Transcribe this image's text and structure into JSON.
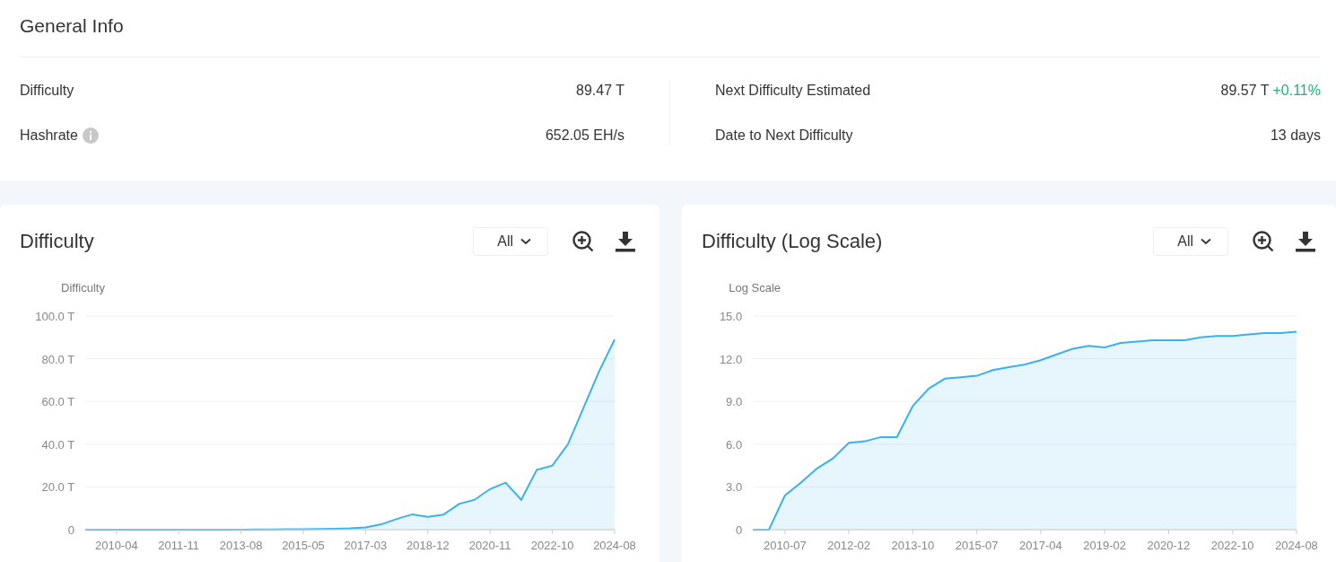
{
  "general_info": {
    "title": "General Info",
    "left": [
      {
        "label": "Difficulty",
        "value": "89.47 T",
        "info": false
      },
      {
        "label": "Hashrate",
        "value": "652.05 EH/s",
        "info": true
      }
    ],
    "right": [
      {
        "label": "Next Difficulty Estimated",
        "value": "89.57 T",
        "change": "+0.11%"
      },
      {
        "label": "Date to Next Difficulty",
        "value": "13 days"
      }
    ]
  },
  "panels": [
    {
      "title": "Difficulty",
      "range": "All",
      "chart_data": {
        "type": "area",
        "categories": [
          null,
          null,
          "2010-04",
          null,
          null,
          null,
          "2011-11",
          null,
          null,
          null,
          "2013-08",
          null,
          null,
          null,
          "2015-05",
          null,
          null,
          null,
          "2017-03",
          null,
          null,
          null,
          "2018-12",
          null,
          null,
          null,
          "2020-11",
          null,
          null,
          null,
          "2022-10",
          null,
          null,
          null,
          "2024-08"
        ],
        "series": [
          {
            "name": "Difficulty",
            "color": "#3bb0ef",
            "values": [
              0,
              0,
              0,
              0,
              0,
              0,
              0,
              0,
              0,
              0,
              0,
              0.1,
              0.1,
              0.2,
              0.2,
              0.3,
              0.4,
              0.6,
              1,
              2.5,
              5,
              7.2,
              6,
              7,
              12,
              14,
              19,
              22,
              14,
              28,
              30,
              40,
              57,
              74,
              89
            ]
          }
        ],
        "ylim": [
          0,
          100
        ],
        "grid": true,
        "yticks": [
          {
            "value": 0,
            "label": "0"
          },
          {
            "value": 20,
            "label": "20.0 T"
          },
          {
            "value": 40,
            "label": "40.0 T"
          },
          {
            "value": 60,
            "label": "60.0 T"
          },
          {
            "value": 80,
            "label": "80.0 T"
          },
          {
            "value": 100,
            "label": "100.0 T"
          }
        ]
      }
    },
    {
      "title": "Difficulty (Log Scale)",
      "range": "All",
      "chart_data": {
        "type": "area",
        "categories": [
          null,
          null,
          "2010-07",
          null,
          null,
          null,
          "2012-02",
          null,
          null,
          null,
          "2013-10",
          null,
          null,
          null,
          "2015-07",
          null,
          null,
          null,
          "2017-04",
          null,
          null,
          null,
          "2019-02",
          null,
          null,
          null,
          "2020-12",
          null,
          null,
          null,
          "2022-10",
          null,
          null,
          null,
          "2024-08"
        ],
        "series": [
          {
            "name": "Log Scale",
            "color": "#3bb0ef",
            "values": [
              0,
              0,
              2.4,
              3.3,
              4.3,
              5.0,
              6.1,
              6.2,
              6.5,
              6.5,
              8.7,
              9.9,
              10.6,
              10.7,
              10.8,
              11.2,
              11.4,
              11.6,
              11.9,
              12.3,
              12.7,
              12.9,
              12.8,
              13.1,
              13.2,
              13.3,
              13.3,
              13.3,
              13.5,
              13.6,
              13.6,
              13.7,
              13.8,
              13.8,
              13.9
            ]
          }
        ],
        "ylim": [
          0,
          15
        ],
        "grid": true,
        "yticks": [
          {
            "value": 0,
            "label": "0"
          },
          {
            "value": 3,
            "label": "3.0"
          },
          {
            "value": 6,
            "label": "6.0"
          },
          {
            "value": 9,
            "label": "9.0"
          },
          {
            "value": 12,
            "label": "12.0"
          },
          {
            "value": 15,
            "label": "15.0"
          }
        ]
      }
    }
  ]
}
